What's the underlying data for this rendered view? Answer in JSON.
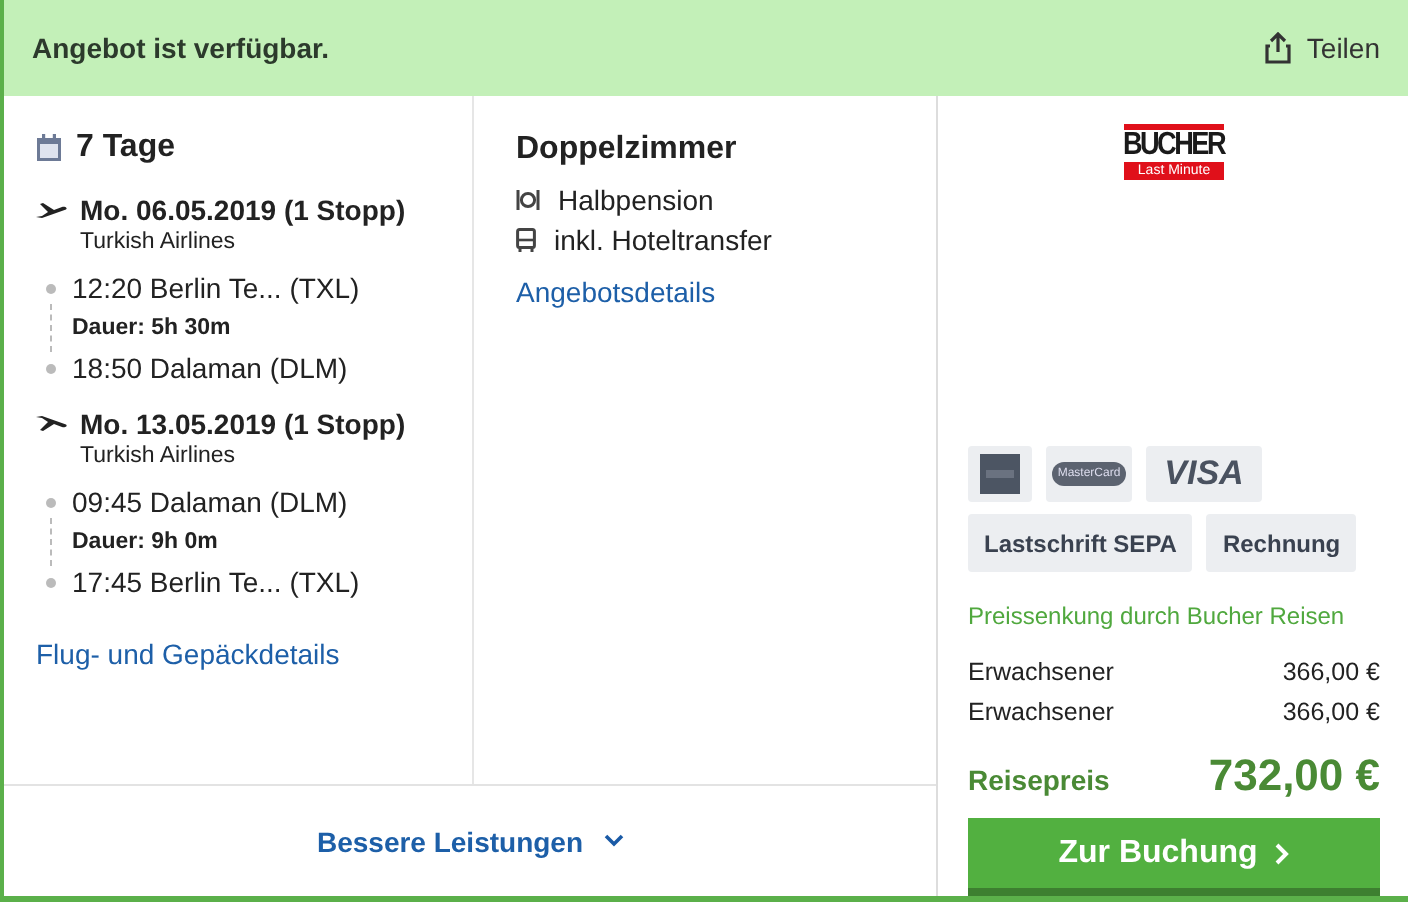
{
  "header": {
    "status": "Angebot ist verfügbar.",
    "share": "Teilen"
  },
  "trip": {
    "duration": "7 Tage",
    "flights": [
      {
        "kind": "outbound",
        "date": "Mo. 06.05.2019 (1 Stopp)",
        "airline": "Turkish Airlines",
        "depart": "12:20 Berlin Te...  (TXL)",
        "duration": "Dauer: 5h 30m",
        "arrive": "18:50 Dalaman (DLM)"
      },
      {
        "kind": "return",
        "date": "Mo. 13.05.2019 (1 Stopp)",
        "airline": "Turkish Airlines",
        "depart": "09:45 Dalaman (DLM)",
        "duration": "Dauer: 9h 0m",
        "arrive": "17:45 Berlin Te...  (TXL)"
      }
    ],
    "details_link": "Flug- und Gepäckdetails"
  },
  "room": {
    "title": "Doppelzimmer",
    "features": [
      {
        "kind": "meal",
        "label": "Halbpension"
      },
      {
        "kind": "bus",
        "label": "inkl. Hoteltransfer"
      }
    ],
    "details_link": "Angebotsdetails"
  },
  "more_button": "Bessere Leistungen",
  "operator": {
    "name": "BUCHER",
    "tagline": "Last Minute"
  },
  "payment_cards": [
    {
      "kind": "amex"
    },
    {
      "kind": "mastercard",
      "label": "MasterCard"
    },
    {
      "kind": "visa",
      "label": "VISA"
    }
  ],
  "payment_methods": [
    "Lastschrift SEPA",
    "Rechnung"
  ],
  "price_note": "Preissenkung durch Bucher Reisen",
  "prices": [
    {
      "label": "Erwachsener",
      "amount": "366,00 €"
    },
    {
      "label": "Erwachsener",
      "amount": "366,00 €"
    }
  ],
  "total": {
    "label": "Reisepreis",
    "amount": "732,00 €"
  },
  "book_button": "Zur Buchung"
}
